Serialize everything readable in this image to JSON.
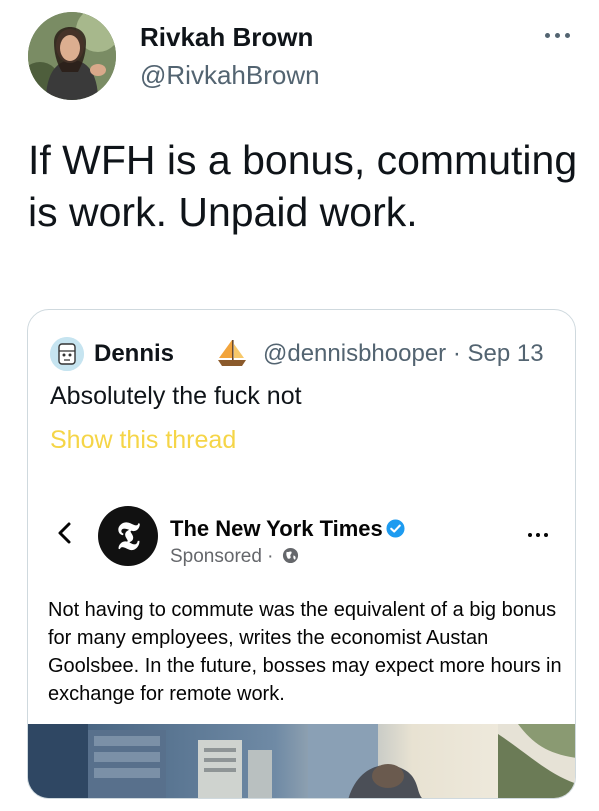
{
  "tweet": {
    "author_name": "Rivkah Brown",
    "author_handle": "@RivkahBrown",
    "text": "If WFH is a bonus, commuting is work. Unpaid work."
  },
  "quote": {
    "name": "Dennis",
    "emoji_icon": "sailboat-icon",
    "handle_date": "@dennisbhooper · Sep 13",
    "text": "Absolutely the fuck not",
    "show_thread": "Show this thread",
    "thread_color": "#f5d547"
  },
  "ad": {
    "advertiser": "The New York Times",
    "sponsored": "Sponsored ·",
    "body": "Not having to commute was the equivalent of a big bonus for many employees, writes the economist Austan Goolsbee. In the future, bosses may expect more hours in exchange for remote work."
  },
  "colors": {
    "handle_gray": "#536471",
    "border": "#cfd9de",
    "verified_blue": "#1d9bf0"
  }
}
